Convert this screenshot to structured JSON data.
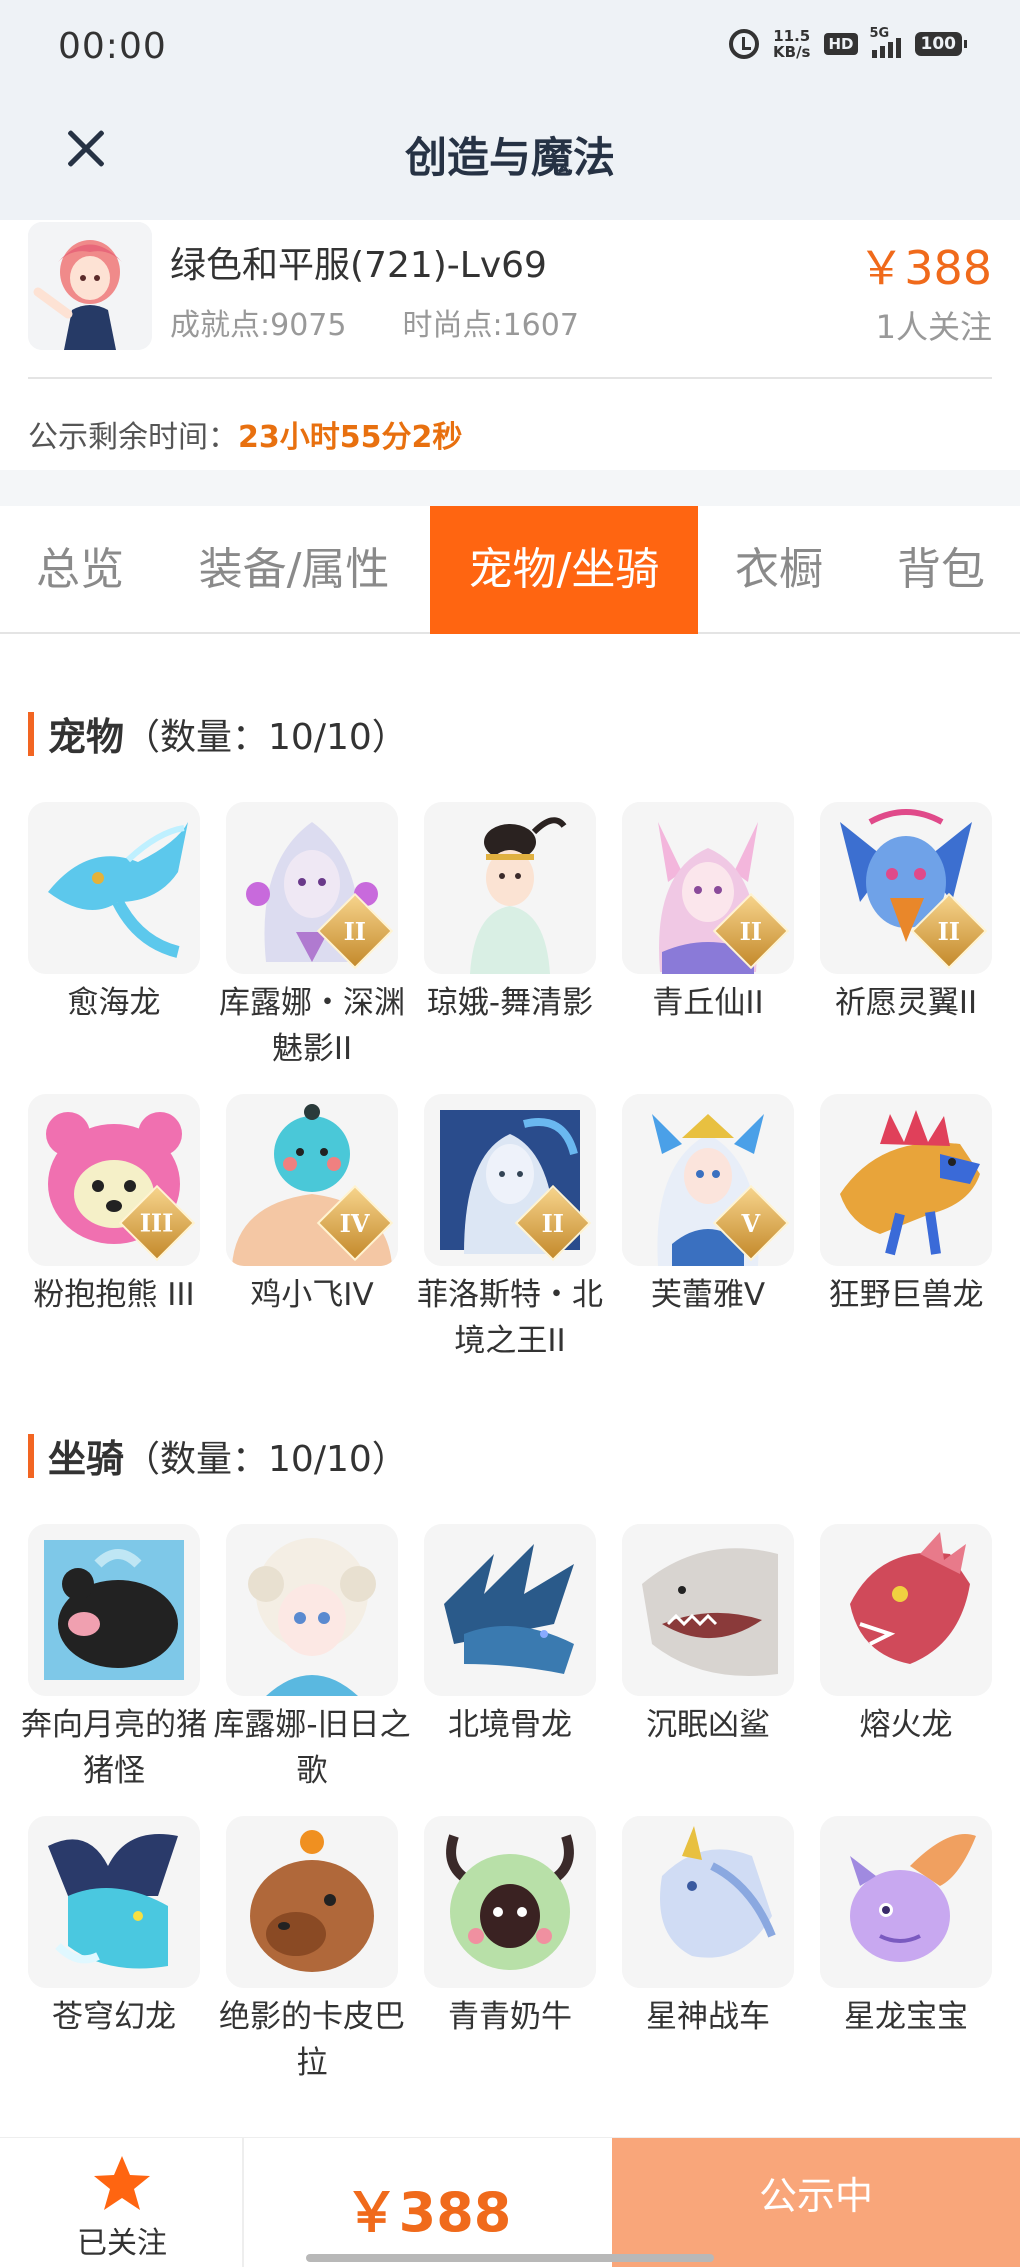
{
  "status_bar": {
    "time": "00:00",
    "speed_value": "11.5",
    "speed_unit": "KB/s",
    "hd": "HD",
    "network": "5G",
    "battery": "100"
  },
  "header": {
    "title": "创造与魔法"
  },
  "character": {
    "name": "绿色和平服(721)-Lv69",
    "achievement": "成就点:9075",
    "fashion": "时尚点:1607",
    "price": "￥388",
    "followers": "1人关注"
  },
  "notice": {
    "label": "公示剩余时间：",
    "time": "23小时55分2秒"
  },
  "tabs": [
    {
      "label": "总览"
    },
    {
      "label": "装备/属性"
    },
    {
      "label": "宠物/坐骑"
    },
    {
      "label": "衣橱"
    },
    {
      "label": "背包"
    }
  ],
  "pets": {
    "title": "宠物",
    "count": "（数量：10/10）",
    "items": [
      {
        "name": "愈海龙",
        "tier": "",
        "icon": "sea-dragon-icon"
      },
      {
        "name": "库露娜・深渊魅影II",
        "tier": "II",
        "icon": "kuluna-icon"
      },
      {
        "name": "琼娥-舞清影",
        "tier": "",
        "icon": "qiong-e-icon"
      },
      {
        "name": "青丘仙II",
        "tier": "II",
        "icon": "fox-fairy-icon"
      },
      {
        "name": "祈愿灵翼II",
        "tier": "II",
        "icon": "griffin-icon"
      },
      {
        "name": "粉抱抱熊 III",
        "tier": "III",
        "icon": "pink-bear-icon"
      },
      {
        "name": "鸡小飞IV",
        "tier": "IV",
        "icon": "chick-icon"
      },
      {
        "name": "菲洛斯特・北境之王II",
        "tier": "II",
        "icon": "frost-king-icon"
      },
      {
        "name": "芙蕾雅V",
        "tier": "V",
        "icon": "freya-icon"
      },
      {
        "name": "狂野巨兽龙",
        "tier": "",
        "icon": "wild-dino-icon"
      }
    ]
  },
  "mounts": {
    "title": "坐骑",
    "count": "（数量：10/10）",
    "items": [
      {
        "name": "奔向月亮的猪猪怪",
        "icon": "moon-pig-icon"
      },
      {
        "name": "库露娜-旧日之歌",
        "icon": "kuluna-song-icon"
      },
      {
        "name": "北境骨龙",
        "icon": "bone-dragon-icon"
      },
      {
        "name": "沉眠凶鲨",
        "icon": "shark-icon"
      },
      {
        "name": "熔火龙",
        "icon": "lava-dragon-icon"
      },
      {
        "name": "苍穹幻龙",
        "icon": "sky-dragon-icon"
      },
      {
        "name": "绝影的卡皮巴拉",
        "icon": "capybara-icon"
      },
      {
        "name": "青青奶牛",
        "icon": "green-cow-icon"
      },
      {
        "name": "星神战车",
        "icon": "star-chariot-icon"
      },
      {
        "name": "星龙宝宝",
        "icon": "baby-dragon-icon"
      }
    ]
  },
  "bottom_bar": {
    "follow_label": "已关注",
    "price": "￥388",
    "status": "公示中"
  },
  "colors": {
    "accent": "#ff6511",
    "price": "#f06a1b",
    "status_button": "#f9a67a"
  }
}
